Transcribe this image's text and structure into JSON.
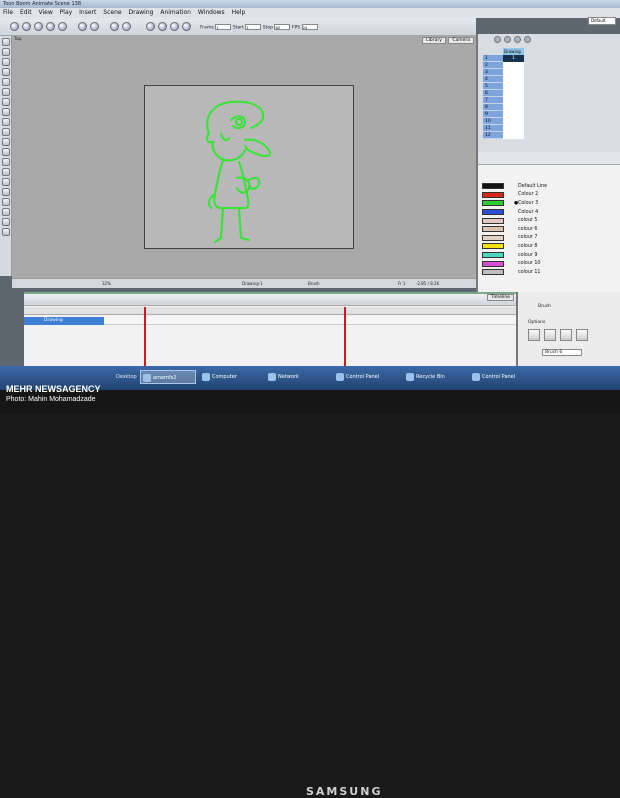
{
  "app": {
    "title": "Toon Boom Animate Scene 138",
    "menu": [
      "File",
      "Edit",
      "View",
      "Play",
      "Insert",
      "Scene",
      "Drawing",
      "Animation",
      "Windows",
      "Help"
    ],
    "layout_value": "Default"
  },
  "toolbar": {
    "frame_label": "Frame",
    "frame_value": "1",
    "start_label": "Start",
    "start_value": "1",
    "stop_label": "Stop",
    "stop_value": "60",
    "fps_label": "FPS",
    "fps_value": "24"
  },
  "camera": {
    "view_label": "Top",
    "tabs": [
      "Library",
      "Camera"
    ],
    "status_zoom": "32%",
    "status_drawing": "Drawing-1",
    "status_tool": "Brush",
    "status_frame": "Fr 1",
    "status_coords": "-2.85 / 8.26"
  },
  "xsheet": {
    "column_name": "Drawing",
    "selected_cell": "1",
    "rows": [
      "1",
      "2",
      "3",
      "4",
      "5",
      "6",
      "7",
      "8",
      "9",
      "10",
      "11",
      "12"
    ]
  },
  "palette": {
    "colors": [
      {
        "name": "Default Line",
        "hex": "#111111",
        "selected": false
      },
      {
        "name": "Colour 2",
        "hex": "#d8261c",
        "selected": false
      },
      {
        "name": "Colour 3",
        "hex": "#2ecc2e",
        "selected": true
      },
      {
        "name": "Colour 4",
        "hex": "#2d4fd8",
        "selected": false
      },
      {
        "name": "colour 5",
        "hex": "#e0c7c0",
        "selected": false
      },
      {
        "name": "colour 6",
        "hex": "#d8c4b0",
        "selected": false
      },
      {
        "name": "colour 7",
        "hex": "#e4d2c4",
        "selected": false
      },
      {
        "name": "colour 8",
        "hex": "#f0e20f",
        "selected": false
      },
      {
        "name": "colour 9",
        "hex": "#4fd6b8",
        "selected": false
      },
      {
        "name": "colour 10",
        "hex": "#d44fd6",
        "selected": false
      },
      {
        "name": "colour 11",
        "hex": "#bfbfbf",
        "selected": false
      }
    ]
  },
  "timeline": {
    "tab": "Timeline",
    "layer_name": "Drawing"
  },
  "brush_panel": {
    "title": "Brush",
    "options_label": "Options",
    "brush_field": "Brush 6"
  },
  "taskbar": {
    "desktop_label": "Desktop",
    "items": [
      "amamfs2",
      "Computer",
      "Network",
      "Control Panel",
      "Recycle Bin",
      "Control Panel"
    ]
  },
  "watermark": {
    "agency": "MEHR NEWSAGENCY",
    "photo": "Photo: Mahin Mohamadzade"
  },
  "bezel": {
    "brand": "SAMSUNG"
  },
  "colors": {
    "drawing_line": "#33e633",
    "playhead": "#d21a1a",
    "layer_selected": "#3f7fd6"
  }
}
